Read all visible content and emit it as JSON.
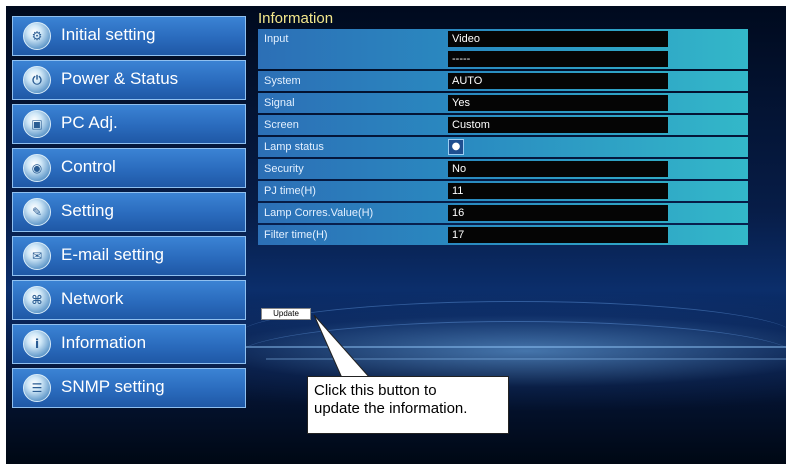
{
  "sidebar": {
    "items": [
      {
        "label": "Initial setting",
        "icon": "settings-icon"
      },
      {
        "label": "Power & Status",
        "icon": "power-icon"
      },
      {
        "label": "PC Adj.",
        "icon": "pc-adjust-icon"
      },
      {
        "label": "Control",
        "icon": "control-icon"
      },
      {
        "label": "Setting",
        "icon": "setting-icon"
      },
      {
        "label": "E-mail setting",
        "icon": "email-icon"
      },
      {
        "label": "Network",
        "icon": "network-icon"
      },
      {
        "label": "Information",
        "icon": "information-icon"
      },
      {
        "label": "SNMP setting",
        "icon": "snmp-icon"
      }
    ]
  },
  "info": {
    "title": "Information",
    "rows": [
      {
        "label": "Input",
        "value": "Video",
        "value2": "-----"
      },
      {
        "label": "System",
        "value": "AUTO"
      },
      {
        "label": "Signal",
        "value": "Yes"
      },
      {
        "label": "Screen",
        "value": "Custom"
      },
      {
        "label": "Lamp status",
        "icon": "lamp-icon"
      },
      {
        "label": "Security",
        "value": "No"
      },
      {
        "label": "PJ time(H)",
        "value": "11"
      },
      {
        "label": "Lamp Corres.Value(H)",
        "value": "16"
      },
      {
        "label": "Filter time(H)",
        "value": "17"
      }
    ],
    "update_label": "Update"
  },
  "callout": {
    "text": "Click this button to\nupdate the information."
  },
  "colors": {
    "title": "#f3e78b",
    "sidebar_button": "#2a6bbd",
    "row_gradient_start": "#2c6fb6",
    "row_gradient_end": "#33b8c9",
    "value_box": "#050505",
    "background": "#0b2e6b"
  }
}
